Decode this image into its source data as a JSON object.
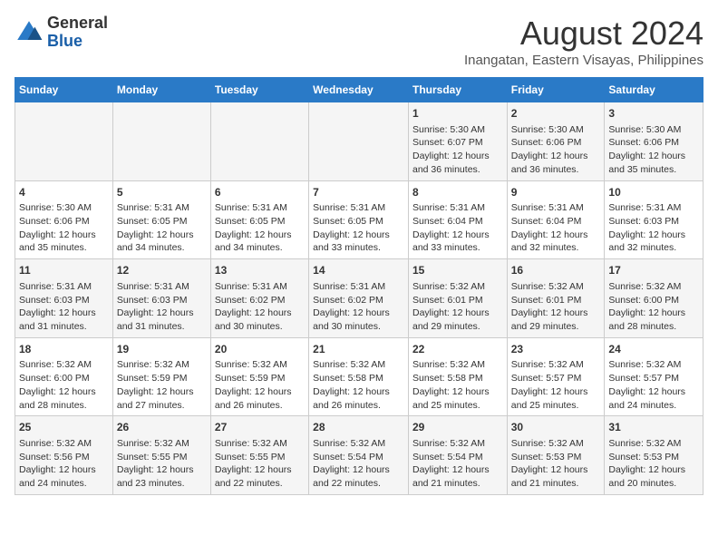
{
  "header": {
    "logo_line1": "General",
    "logo_line2": "Blue",
    "title": "August 2024",
    "subtitle": "Inangatan, Eastern Visayas, Philippines"
  },
  "columns": [
    "Sunday",
    "Monday",
    "Tuesday",
    "Wednesday",
    "Thursday",
    "Friday",
    "Saturday"
  ],
  "weeks": [
    [
      {
        "day": "",
        "content": ""
      },
      {
        "day": "",
        "content": ""
      },
      {
        "day": "",
        "content": ""
      },
      {
        "day": "",
        "content": ""
      },
      {
        "day": "1",
        "content": "Sunrise: 5:30 AM\nSunset: 6:07 PM\nDaylight: 12 hours and 36 minutes."
      },
      {
        "day": "2",
        "content": "Sunrise: 5:30 AM\nSunset: 6:06 PM\nDaylight: 12 hours and 36 minutes."
      },
      {
        "day": "3",
        "content": "Sunrise: 5:30 AM\nSunset: 6:06 PM\nDaylight: 12 hours and 35 minutes."
      }
    ],
    [
      {
        "day": "4",
        "content": "Sunrise: 5:30 AM\nSunset: 6:06 PM\nDaylight: 12 hours and 35 minutes."
      },
      {
        "day": "5",
        "content": "Sunrise: 5:31 AM\nSunset: 6:05 PM\nDaylight: 12 hours and 34 minutes."
      },
      {
        "day": "6",
        "content": "Sunrise: 5:31 AM\nSunset: 6:05 PM\nDaylight: 12 hours and 34 minutes."
      },
      {
        "day": "7",
        "content": "Sunrise: 5:31 AM\nSunset: 6:05 PM\nDaylight: 12 hours and 33 minutes."
      },
      {
        "day": "8",
        "content": "Sunrise: 5:31 AM\nSunset: 6:04 PM\nDaylight: 12 hours and 33 minutes."
      },
      {
        "day": "9",
        "content": "Sunrise: 5:31 AM\nSunset: 6:04 PM\nDaylight: 12 hours and 32 minutes."
      },
      {
        "day": "10",
        "content": "Sunrise: 5:31 AM\nSunset: 6:03 PM\nDaylight: 12 hours and 32 minutes."
      }
    ],
    [
      {
        "day": "11",
        "content": "Sunrise: 5:31 AM\nSunset: 6:03 PM\nDaylight: 12 hours and 31 minutes."
      },
      {
        "day": "12",
        "content": "Sunrise: 5:31 AM\nSunset: 6:03 PM\nDaylight: 12 hours and 31 minutes."
      },
      {
        "day": "13",
        "content": "Sunrise: 5:31 AM\nSunset: 6:02 PM\nDaylight: 12 hours and 30 minutes."
      },
      {
        "day": "14",
        "content": "Sunrise: 5:31 AM\nSunset: 6:02 PM\nDaylight: 12 hours and 30 minutes."
      },
      {
        "day": "15",
        "content": "Sunrise: 5:32 AM\nSunset: 6:01 PM\nDaylight: 12 hours and 29 minutes."
      },
      {
        "day": "16",
        "content": "Sunrise: 5:32 AM\nSunset: 6:01 PM\nDaylight: 12 hours and 29 minutes."
      },
      {
        "day": "17",
        "content": "Sunrise: 5:32 AM\nSunset: 6:00 PM\nDaylight: 12 hours and 28 minutes."
      }
    ],
    [
      {
        "day": "18",
        "content": "Sunrise: 5:32 AM\nSunset: 6:00 PM\nDaylight: 12 hours and 28 minutes."
      },
      {
        "day": "19",
        "content": "Sunrise: 5:32 AM\nSunset: 5:59 PM\nDaylight: 12 hours and 27 minutes."
      },
      {
        "day": "20",
        "content": "Sunrise: 5:32 AM\nSunset: 5:59 PM\nDaylight: 12 hours and 26 minutes."
      },
      {
        "day": "21",
        "content": "Sunrise: 5:32 AM\nSunset: 5:58 PM\nDaylight: 12 hours and 26 minutes."
      },
      {
        "day": "22",
        "content": "Sunrise: 5:32 AM\nSunset: 5:58 PM\nDaylight: 12 hours and 25 minutes."
      },
      {
        "day": "23",
        "content": "Sunrise: 5:32 AM\nSunset: 5:57 PM\nDaylight: 12 hours and 25 minutes."
      },
      {
        "day": "24",
        "content": "Sunrise: 5:32 AM\nSunset: 5:57 PM\nDaylight: 12 hours and 24 minutes."
      }
    ],
    [
      {
        "day": "25",
        "content": "Sunrise: 5:32 AM\nSunset: 5:56 PM\nDaylight: 12 hours and 24 minutes."
      },
      {
        "day": "26",
        "content": "Sunrise: 5:32 AM\nSunset: 5:55 PM\nDaylight: 12 hours and 23 minutes."
      },
      {
        "day": "27",
        "content": "Sunrise: 5:32 AM\nSunset: 5:55 PM\nDaylight: 12 hours and 22 minutes."
      },
      {
        "day": "28",
        "content": "Sunrise: 5:32 AM\nSunset: 5:54 PM\nDaylight: 12 hours and 22 minutes."
      },
      {
        "day": "29",
        "content": "Sunrise: 5:32 AM\nSunset: 5:54 PM\nDaylight: 12 hours and 21 minutes."
      },
      {
        "day": "30",
        "content": "Sunrise: 5:32 AM\nSunset: 5:53 PM\nDaylight: 12 hours and 21 minutes."
      },
      {
        "day": "31",
        "content": "Sunrise: 5:32 AM\nSunset: 5:53 PM\nDaylight: 12 hours and 20 minutes."
      }
    ]
  ]
}
